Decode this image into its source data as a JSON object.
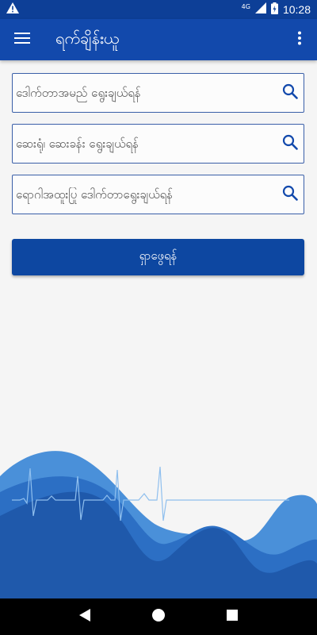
{
  "status_bar": {
    "network": "4G",
    "time": "10:28"
  },
  "app_bar": {
    "title": "ရက်ချိန်းယူ"
  },
  "search_fields": [
    {
      "placeholder": "ဒေါက်တာအမည် ရွေးချယ်ရန်",
      "value": ""
    },
    {
      "placeholder": "ဆေးရုံ၊ ဆေးခန်း ရွေးချယ်ရန်",
      "value": ""
    },
    {
      "placeholder": "ရောဂါအထူးပြု ဒေါက်တာရွေးချယ်ရန်",
      "value": ""
    }
  ],
  "search_button": {
    "label": "ရှာဖွေရန်"
  },
  "colors": {
    "primary": "#1249ac",
    "primary_dark": "#0d3f97",
    "button": "#0d47a1",
    "wave_light": "#4a90d9",
    "wave_mid": "#2c6fc4",
    "wave_dark": "#1e56a8"
  },
  "icons": {
    "warning": "warning-icon",
    "battery": "battery-icon",
    "signal": "signal-icon",
    "menu": "hamburger-menu-icon",
    "more": "more-vert-icon",
    "search": "search-icon",
    "back": "back-triangle-icon",
    "home": "home-circle-icon",
    "recents": "recents-square-icon"
  }
}
